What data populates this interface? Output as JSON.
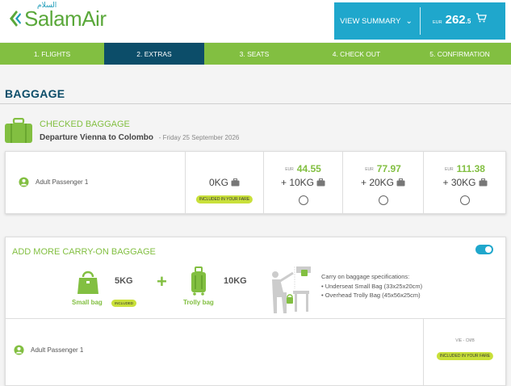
{
  "header": {
    "logo_text": "SalamAir",
    "logo_arabic": "السلام",
    "view_summary_label": "VIEW SUMMARY",
    "price_currency": "EUR",
    "price_integer": "262",
    "price_decimal": ".5"
  },
  "steps": [
    {
      "label": "1. FLIGHTS"
    },
    {
      "label": "2. EXTRAS"
    },
    {
      "label": "3. SEATS"
    },
    {
      "label": "4. CHECK OUT"
    },
    {
      "label": "5. CONFIRMATION"
    }
  ],
  "section_title": "BAGGAGE",
  "checked": {
    "title": "CHECKED BAGGAGE",
    "route": "Departure Vienna to Colombo",
    "date": "- Friday 25 September 2026",
    "passenger": "Adult Passenger 1",
    "options": [
      {
        "kg": "0KG",
        "included": "INCLUDED IN YOUR FARE"
      },
      {
        "currency": "EUR",
        "price": "44.55",
        "kg": "+ 10KG"
      },
      {
        "currency": "EUR",
        "price": "77.97",
        "kg": "+ 20KG"
      },
      {
        "currency": "EUR",
        "price": "111.38",
        "kg": "+ 30KG"
      }
    ]
  },
  "carry": {
    "title": "ADD MORE CARRY-ON BAGGAGE",
    "toggle_on": true,
    "small_kg": "5KG",
    "small_label": "Small bag",
    "small_included": "INCLUDED",
    "trolly_kg": "10KG",
    "trolly_label": "Trolly bag",
    "spec_title": "Carry on baggage specifications:",
    "spec_1": "• Underseat Small Bag (33x25x20cm)",
    "spec_2": "• Overhead Trolly Bag (45x56x25cm)",
    "passenger": "Adult Passenger 1",
    "route_code": "VIE - CMB",
    "included": "INCLUDED IN YOUR FARE"
  },
  "colors": {
    "brand_green": "#82bf41",
    "brand_navy": "#0c4d69",
    "brand_blue": "#1fa7cc",
    "pill_lime": "#c9e03a"
  }
}
